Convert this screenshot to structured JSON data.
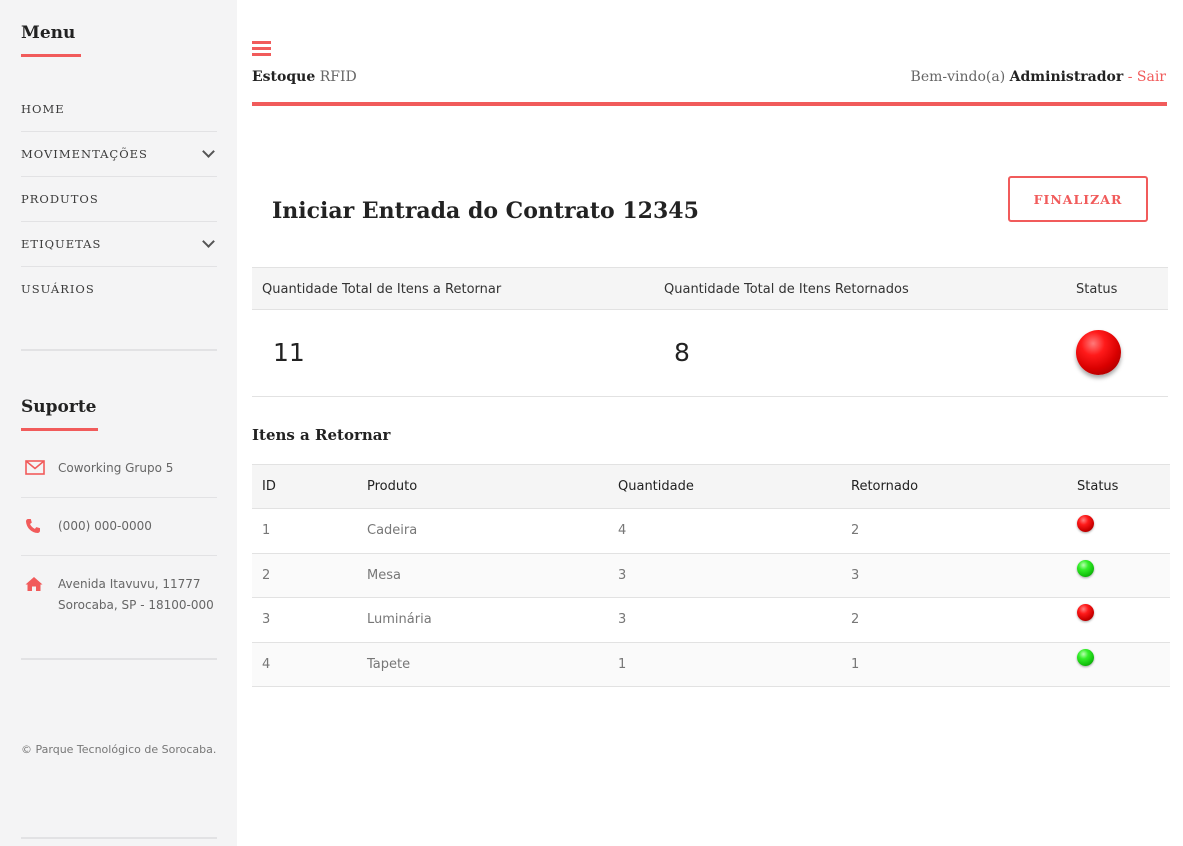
{
  "sidebar": {
    "menu_title": "Menu",
    "items": [
      {
        "label": "HOME",
        "has_submenu": false
      },
      {
        "label": "MOVIMENTAÇÕES",
        "has_submenu": true
      },
      {
        "label": "PRODUTOS",
        "has_submenu": false
      },
      {
        "label": "ETIQUETAS",
        "has_submenu": true
      },
      {
        "label": "USUÁRIOS",
        "has_submenu": false
      }
    ],
    "support_title": "Suporte",
    "support": {
      "company": "Coworking Grupo 5",
      "phone": "(000) 000-0000",
      "address_line1": "Avenida Itavuvu, 11777",
      "address_line2": "Sorocaba, SP - 18100-000"
    },
    "copyright": "© Parque Tecnológico de Sorocaba."
  },
  "header": {
    "brand_bold": "Estoque",
    "brand_light": "RFID",
    "welcome_prefix": "Bem-vindo(a)",
    "user_name": "Administrador",
    "separator": "-",
    "logout_label": "Sair"
  },
  "page": {
    "title": "Iniciar Entrada do Contrato 12345",
    "finalize_label": "FINALIZAR"
  },
  "summary": {
    "col_total": "Quantidade Total de Itens a Retornar",
    "col_returned": "Quantidade Total de Itens Retornados",
    "col_status": "Status",
    "total": "11",
    "returned": "8",
    "status": "red"
  },
  "items": {
    "section_title": "Itens a Retornar",
    "headers": {
      "id": "ID",
      "product": "Produto",
      "quantity": "Quantidade",
      "returned": "Retornado",
      "status": "Status"
    },
    "rows": [
      {
        "id": "1",
        "product": "Cadeira",
        "quantity": "4",
        "returned": "2",
        "status": "red"
      },
      {
        "id": "2",
        "product": "Mesa",
        "quantity": "3",
        "returned": "3",
        "status": "green"
      },
      {
        "id": "3",
        "product": "Luminária",
        "quantity": "3",
        "returned": "2",
        "status": "red"
      },
      {
        "id": "4",
        "product": "Tapete",
        "quantity": "1",
        "returned": "1",
        "status": "green"
      }
    ]
  },
  "colors": {
    "accent": "#f15b5b",
    "status_red": "#e00000",
    "status_green": "#22d41a"
  }
}
